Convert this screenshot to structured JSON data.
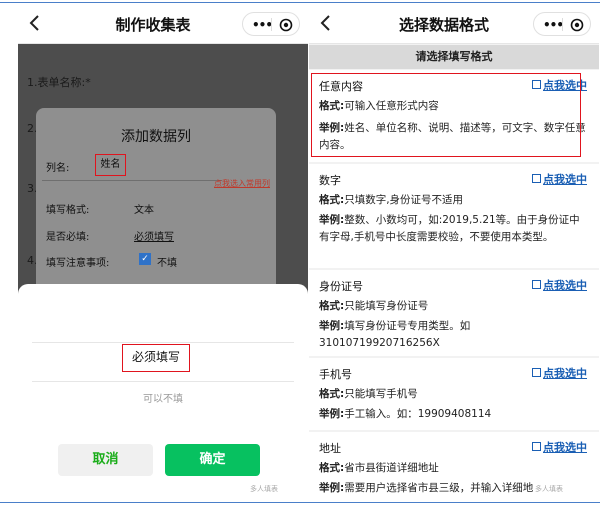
{
  "left": {
    "title": "制作收集表",
    "form_item_1": "1.表单名称:*",
    "form_item_2": "2.",
    "form_item_3": "3.",
    "form_item_4": "4.",
    "modal": {
      "title": "添加数据列",
      "name_label": "列名:",
      "name_value": "姓名",
      "quick_link": "点我选入常用列",
      "format_label": "填写格式:",
      "format_value": "文本",
      "required_label": "是否必填:",
      "required_value": "必须填写",
      "notes_label": "填写注意事项:",
      "notes_value": "不填"
    },
    "sheet": {
      "option_required": "必须填写",
      "option_optional": "可以不填",
      "cancel": "取消",
      "confirm": "确定"
    },
    "watermark": "多人填表"
  },
  "right": {
    "title": "选择数据格式",
    "subheader": "请选择填写格式",
    "select_label": "点我选中",
    "format_prefix": "格式:",
    "example_prefix": "举例:",
    "cards": [
      {
        "name": "任意内容",
        "format": "可输入任意形式内容",
        "example": "姓名、单位名称、说明、描述等，可文字、数字任意内容。"
      },
      {
        "name": "数字",
        "format": "只填数字,身份证号不适用",
        "example": "整数、小数均可，如:2019,5.21等。由于身份证中有字母,手机号中长度需要校验，不要使用本类型。"
      },
      {
        "name": "身份证号",
        "format": "只能填写身份证号",
        "example": "填写身份证号专用类型。如31010719920716256X"
      },
      {
        "name": "手机号",
        "format": "只能填写手机号",
        "example": "手工输入。如：19909408114"
      },
      {
        "name": "地址",
        "format": "省市县街道详细地址",
        "example": "需要用户选择省市县三级，并输入详细地"
      }
    ],
    "watermark": "多人填表"
  },
  "colors": {
    "accent_green": "#07c160",
    "highlight_red": "#e0141e",
    "link_blue": "#1a5fb4"
  },
  "icons": [
    "back-arrow-icon",
    "more-dots-icon",
    "target-icon",
    "external-link-icon",
    "checkbox-icon"
  ]
}
